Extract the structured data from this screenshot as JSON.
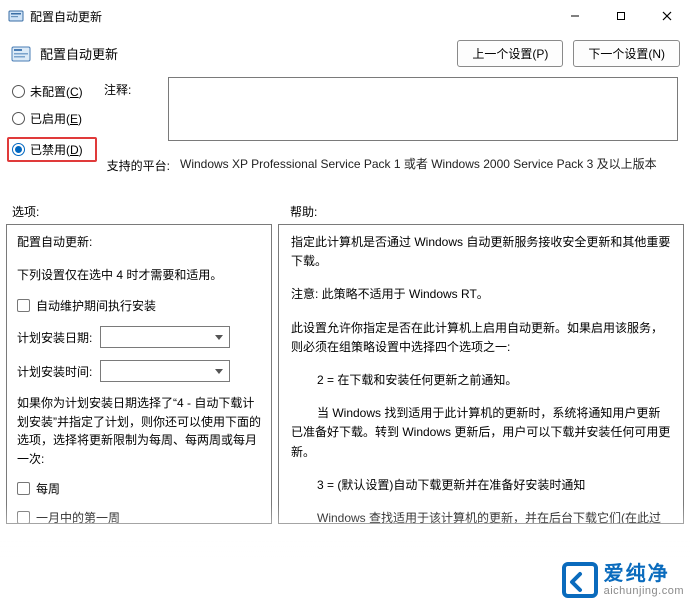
{
  "window": {
    "title": "配置自动更新",
    "sub_title": "配置自动更新"
  },
  "nav": {
    "prev": "上一个设置(P)",
    "next": "下一个设置(N)"
  },
  "radios": {
    "not_configured": "未配置(C)",
    "enabled": "已启用(E)",
    "disabled": "已禁用(D)",
    "selected": "disabled"
  },
  "comment": {
    "label": "注释:",
    "value": ""
  },
  "platform": {
    "label": "支持的平台:",
    "value": "Windows XP Professional Service Pack 1 或者 Windows 2000 Service Pack 3 及以上版本"
  },
  "sections": {
    "options_label": "选项:",
    "help_label": "帮助:"
  },
  "options": {
    "title": "配置自动更新:",
    "note": "下列设置仅在选中 4 时才需要和适用。",
    "checkbox_maint": "自动维护期间执行安装",
    "sched_date_label": "计划安装日期:",
    "sched_time_label": "计划安装时间:",
    "para": "如果你为计划安装日期选择了“4 - 自动下载计划安装”并指定了计划，则你还可以使用下面的选项，选择将更新限制为每周、每两周或每月一次:",
    "chk_weekly": "每周",
    "chk_first_week": "一月中的第一周"
  },
  "help": {
    "p1": "指定此计算机是否通过 Windows 自动更新服务接收安全更新和其他重要下载。",
    "p2": "注意: 此策略不适用于 Windows RT。",
    "p3": "此设置允许你指定是否在此计算机上启用自动更新。如果启用该服务，则必须在组策略设置中选择四个选项之一:",
    "opt2": "2 = 在下载和安装任何更新之前通知。",
    "p4": "当 Windows 找到适用于此计算机的更新时，系统将通知用户更新已准备好下载。转到 Windows 更新后，用户可以下载并安装任何可用更新。",
    "opt3": "3 = (默认设置)自动下载更新并在准备好安装时通知",
    "p5a": "Windows 查找适用于该计算机的更新，并在后台下载它们(在此过程中，用户不会收到通知或被打扰)。下载完成后用户将收到通知准备好进行安装。在转到 Windows 更新后",
    "p5b": ""
  },
  "watermark": {
    "cn": "爱纯净",
    "en": "aichunjing.com"
  }
}
